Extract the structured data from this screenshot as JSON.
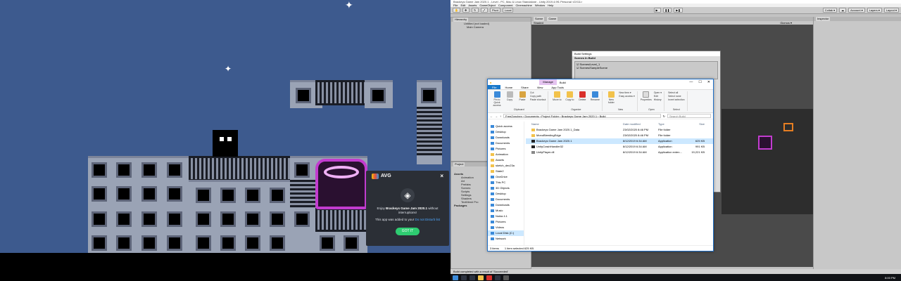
{
  "avg": {
    "brand": "AVG",
    "close": "×",
    "message_pre": "Enjoy ",
    "game": "Brackeys Game Jam 2020.1",
    "message_post": " without interruptions!",
    "added_pre": "This app was added to your ",
    "added_link": "Do not Disturb list",
    "button": "GOT IT"
  },
  "unity": {
    "window_title": "Brackeys Game Jam 2020.1 - Level - PC, Mac & Linux Standalone - Unity 2019.4.9f1 Personal <DX11>",
    "menu": [
      "File",
      "Edit",
      "Assets",
      "GameObject",
      "Component",
      "Cinemachine",
      "Window",
      "Help"
    ],
    "toolbar": {
      "pivot": "Pivot",
      "local": "Local",
      "collab": "Collab ▾",
      "account": "Account ▾",
      "layers": "Layers ▾",
      "layout": "Layout ▾"
    },
    "hierarchy": {
      "tab": "Hierarchy",
      "items": [
        "Untitled (not loaded)",
        "Main Camera"
      ]
    },
    "scene_tabs": [
      "Scene",
      "Game"
    ],
    "scene_mode": "Shaded",
    "gizmos": "Gizmos ▾",
    "inspector_tab": "Inspector",
    "project": {
      "tab": "Project",
      "items": [
        "Assets",
        "Animation",
        "Art",
        "Prefabs",
        "Scenes",
        "Scripts",
        "Settings",
        "Shaders",
        "TextMesh Pro",
        "Packages"
      ]
    },
    "status": "Build completed with a result of 'Succeeded'"
  },
  "build_settings": {
    "title": "Build Settings",
    "scenes_header": "Scenes In Build",
    "scenes": [
      "Scenes/Level_1",
      "Scenes/SampleScene"
    ]
  },
  "explorer": {
    "title_manage": "Manage",
    "title_folder": "Build",
    "ribbon_tabs": [
      "File",
      "Home",
      "Share",
      "View",
      "App Tools"
    ],
    "ribbon_groups": [
      {
        "name": "Clipboard",
        "items": [
          "Pin to Quick access",
          "Copy",
          "Paste"
        ]
      },
      {
        "name": "Organize",
        "items": [
          "Move to",
          "Copy to",
          "Delete",
          "Rename"
        ]
      },
      {
        "name": "New",
        "items": [
          "New folder"
        ]
      },
      {
        "name": "Open",
        "items": [
          "Properties"
        ]
      },
      {
        "name": "Select",
        "items": [
          "Select all"
        ]
      }
    ],
    "cut": "Cut",
    "copy_path": "Copy path",
    "paste_shortcut": "Paste shortcut",
    "new_item": "New item ▾",
    "easy_access": "Easy access ▾",
    "open": "Open ▾",
    "edit": "Edit",
    "history": "History",
    "select_none": "Select none",
    "invert": "Invert selection",
    "path": "FreeZonchen  ›  Documents  ›  Project Folder  ›  Brackeys Game Jam 2020.1  ›  Build",
    "search": "Search Build",
    "nav": [
      {
        "label": "Quick access",
        "kind": "pc"
      },
      {
        "label": "Desktop",
        "kind": "pc"
      },
      {
        "label": "Downloads",
        "kind": "pc"
      },
      {
        "label": "Documents",
        "kind": "pc"
      },
      {
        "label": "Pictures",
        "kind": "pc"
      },
      {
        "label": "Animation",
        "kind": "folder"
      },
      {
        "label": "Assets",
        "kind": "folder"
      },
      {
        "label": "sketch_dec23a",
        "kind": "folder"
      },
      {
        "label": "State2",
        "kind": "folder"
      },
      {
        "label": "OneDrive",
        "kind": "pc"
      },
      {
        "label": "This PC",
        "kind": "pc"
      },
      {
        "label": "3D Objects",
        "kind": "pc"
      },
      {
        "label": "Desktop",
        "kind": "pc"
      },
      {
        "label": "Documents",
        "kind": "pc"
      },
      {
        "label": "Downloads",
        "kind": "pc"
      },
      {
        "label": "Music",
        "kind": "pc"
      },
      {
        "label": "Nokia 4.1",
        "kind": "pc"
      },
      {
        "label": "Pictures",
        "kind": "pc"
      },
      {
        "label": "Videos",
        "kind": "pc"
      },
      {
        "label": "Local Disk (C:)",
        "kind": "pc"
      },
      {
        "label": "Network",
        "kind": "pc"
      }
    ],
    "columns": [
      "Name",
      "Date modified",
      "Type",
      "Size"
    ],
    "files": [
      {
        "name": "Brackeys Game Jam 2020.1_Data",
        "date": "23/02/2020 8:46 PM",
        "type": "File folder",
        "size": "",
        "icon": "#f2c24b"
      },
      {
        "name": "MonoBleedingEdge",
        "date": "23/02/2020 8:46 PM",
        "type": "File folder",
        "size": "",
        "icon": "#f2c24b"
      },
      {
        "name": "Brackeys Game Jam 2020.1",
        "date": "8/12/2019 6:34 AM",
        "type": "Application",
        "size": "625 KB",
        "icon": "#222"
      },
      {
        "name": "UnityCrashHandler32",
        "date": "8/12/2019 6:34 AM",
        "type": "Application",
        "size": "991 KB",
        "icon": "#222"
      },
      {
        "name": "UnityPlayer.dll",
        "date": "8/12/2019 6:34 AM",
        "type": "Application exten...",
        "size": "19,221 KB",
        "icon": "#888"
      }
    ],
    "status_items": "3 items",
    "status_selected": "1 item selected  625 KB"
  },
  "taskbar": {
    "time": "8:00 PM"
  }
}
